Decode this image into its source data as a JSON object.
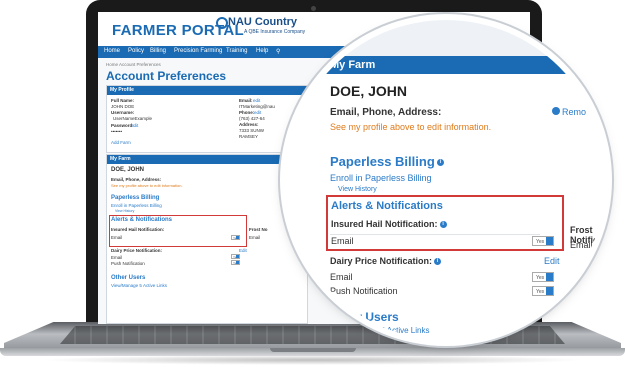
{
  "header": {
    "brand": "FARMER PORTAL",
    "company": "NAU Country",
    "company_sub": "A QBE Insurance Company"
  },
  "nav": {
    "items": [
      "Home",
      "Policy",
      "Billing",
      "Precision Farming",
      "Training",
      "Help"
    ]
  },
  "breadcrumb": "Home  Account Preferences",
  "page_title": "Account Preferences",
  "my_profile": {
    "title": "My Profile",
    "full_name_label": "Full Name:",
    "full_name": "JOHN DOE",
    "username_label": "Username:",
    "username": "UserNameExample",
    "password_label": "Password:",
    "password_edit": "edit",
    "password_mask": "•••••••",
    "add_farm": "Add Farm",
    "email_label": "Email:",
    "email_edit": "edit",
    "email_value": "ITMarketing@nau",
    "phone_label": "Phone:",
    "phone_edit": "edit",
    "phone_value": "(763) 427-64",
    "address_label": "Address:",
    "address_line1": "7333 SUNW",
    "address_line2": "RAMSEY"
  },
  "my_farm": {
    "title": "My Farm",
    "name": "DOE, JOHN",
    "email_phone_address": "Email, Phone, Address:",
    "see_profile": "See my profile above to edit information.",
    "remove": "Remo",
    "paperless_billing": "Paperless Billing",
    "enroll": "Enroll in Paperless Billing",
    "view_history": "View History",
    "alerts": "Alerts & Notifications",
    "insured_hail": "Insured Hail Notification:",
    "email": "Email",
    "toggle_yes": "Yes",
    "frost": "Frost Notificat",
    "frost_email": "Email",
    "frost_short": "Frost No",
    "dairy": "Dairy Price Notification:",
    "edit": "Edit",
    "push": "Push Notification",
    "other_users": "Other Users",
    "view_manage": "View/Manage 5 Active Links"
  },
  "colors": {
    "brand_blue": "#1a6bb3",
    "link_blue": "#2a7bc8",
    "accent_orange": "#e07b1a",
    "highlight_red": "#d23a3a"
  }
}
